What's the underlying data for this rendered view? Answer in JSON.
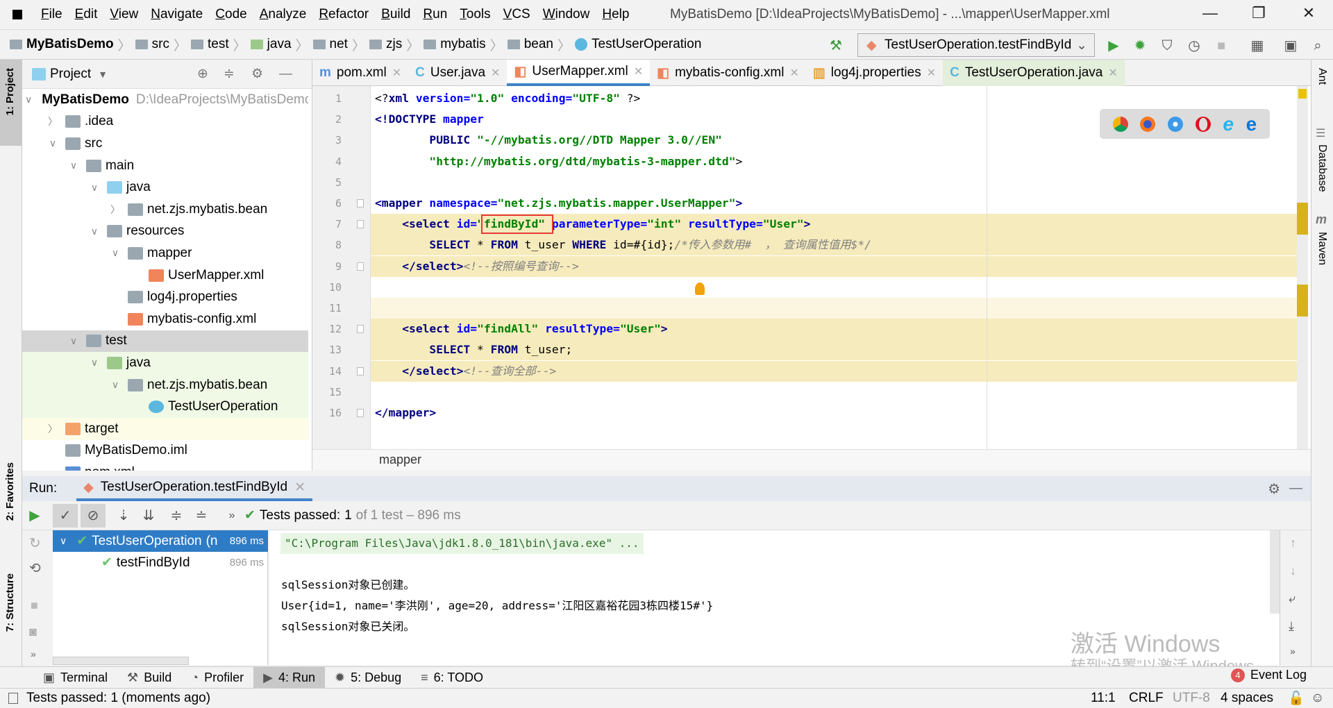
{
  "menu": [
    "File",
    "Edit",
    "View",
    "Navigate",
    "Code",
    "Analyze",
    "Refactor",
    "Build",
    "Run",
    "Tools",
    "VCS",
    "Window",
    "Help"
  ],
  "window_title": "MyBatisDemo [D:\\IdeaProjects\\MyBatisDemo] - ...\\mapper\\UserMapper.xml",
  "breadcrumb": [
    "MyBatisDemo",
    "src",
    "test",
    "java",
    "net",
    "zjs",
    "mybatis",
    "bean",
    "TestUserOperation"
  ],
  "run_config": "TestUserOperation.testFindById",
  "project_panel": {
    "title": "Project",
    "tree": [
      {
        "label": "MyBatisDemo",
        "extra": "D:\\IdeaProjects\\MyBatisDemo",
        "level": 0,
        "state": "open",
        "icon": "module",
        "bold": true
      },
      {
        "label": ".idea",
        "level": 1,
        "state": "closed",
        "icon": "folder"
      },
      {
        "label": "src",
        "level": 1,
        "state": "open",
        "icon": "folder"
      },
      {
        "label": "main",
        "level": 2,
        "state": "open",
        "icon": "folder"
      },
      {
        "label": "java",
        "level": 3,
        "state": "open",
        "icon": "source-folder"
      },
      {
        "label": "net.zjs.mybatis.bean",
        "level": 4,
        "state": "closed",
        "icon": "package"
      },
      {
        "label": "resources",
        "level": 3,
        "state": "open",
        "icon": "resources-folder"
      },
      {
        "label": "mapper",
        "level": 4,
        "state": "open",
        "icon": "package"
      },
      {
        "label": "UserMapper.xml",
        "level": 5,
        "state": "leaf",
        "icon": "xml-file"
      },
      {
        "label": "log4j.properties",
        "level": 4,
        "state": "leaf",
        "icon": "properties-file"
      },
      {
        "label": "mybatis-config.xml",
        "level": 4,
        "state": "leaf",
        "icon": "xml-file"
      },
      {
        "label": "test",
        "level": 2,
        "state": "open",
        "icon": "folder",
        "selected": true
      },
      {
        "label": "java",
        "level": 3,
        "state": "open",
        "icon": "test-folder",
        "bg": "test"
      },
      {
        "label": "net.zjs.mybatis.bean",
        "level": 4,
        "state": "open",
        "icon": "package",
        "bg": "test"
      },
      {
        "label": "TestUserOperation",
        "level": 5,
        "state": "leaf",
        "icon": "class-file",
        "bg": "test"
      },
      {
        "label": "target",
        "level": 1,
        "state": "closed",
        "icon": "excluded-folder",
        "bg": "excluded"
      },
      {
        "label": "MyBatisDemo.iml",
        "level": 1,
        "state": "leaf",
        "icon": "iml-file"
      },
      {
        "label": "pom.xml",
        "level": 1,
        "state": "leaf",
        "icon": "maven-file"
      }
    ]
  },
  "tabs": [
    {
      "label": "pom.xml",
      "icon": "maven-icon"
    },
    {
      "label": "User.java",
      "icon": "class-icon"
    },
    {
      "label": "UserMapper.xml",
      "icon": "xml-icon",
      "active": true
    },
    {
      "label": "mybatis-config.xml",
      "icon": "xml-icon"
    },
    {
      "label": "log4j.properties",
      "icon": "properties-icon"
    },
    {
      "label": "TestUserOperation.java",
      "icon": "test-class-icon",
      "green": true
    }
  ],
  "editor": {
    "lines": [
      [
        [
          "<?",
          "t-pl"
        ],
        [
          "xml ",
          "t-tag"
        ],
        [
          "version=",
          "t-attr"
        ],
        [
          "\"1.0\" ",
          "t-str"
        ],
        [
          "encoding=",
          "t-attr"
        ],
        [
          "\"UTF-8\" ",
          "t-str"
        ],
        [
          "?>",
          "t-pl"
        ]
      ],
      [
        [
          "<!DOCTYPE ",
          "t-tag"
        ],
        [
          "mapper",
          "t-attr"
        ]
      ],
      [
        [
          "        PUBLIC ",
          "t-kw"
        ],
        [
          "\"-//mybatis.org//DTD Mapper 3.0//EN\"",
          "t-str"
        ]
      ],
      [
        [
          "        ",
          "t-pl"
        ],
        [
          "\"http://mybatis.org/dtd/mybatis-3-mapper.dtd\"",
          "t-str"
        ],
        [
          ">",
          "t-pl"
        ]
      ],
      [],
      [
        [
          "<mapper ",
          "t-tag"
        ],
        [
          "namespace=",
          "t-attr"
        ],
        [
          "\"net.zjs.mybatis.mapper.UserMapper\"",
          "t-str"
        ],
        [
          ">",
          "t-tag"
        ]
      ],
      [
        [
          "    <select ",
          "t-tag"
        ],
        [
          "id=",
          "t-attr"
        ],
        [
          "\"findById\"",
          "t-str"
        ],
        [
          " parameterType=",
          "t-attr"
        ],
        [
          "\"int\"",
          "t-str"
        ],
        [
          " resultType=",
          "t-attr"
        ],
        [
          "\"User\"",
          "t-str"
        ],
        [
          ">",
          "t-tag"
        ]
      ],
      [
        [
          "        SELECT ",
          "t-kw"
        ],
        [
          "* ",
          "t-pl"
        ],
        [
          "FROM ",
          "t-kw"
        ],
        [
          "t_user ",
          "t-pl"
        ],
        [
          "WHERE ",
          "t-kw"
        ],
        [
          "id=#{id};",
          "t-pl"
        ],
        [
          "/*传入参数用#  ， 查询属性值用$*/",
          "t-com"
        ]
      ],
      [
        [
          "    </select>",
          "t-tag"
        ],
        [
          "<!--按照编号查询-->",
          "t-com"
        ]
      ],
      [],
      [],
      [
        [
          "    <select ",
          "t-tag"
        ],
        [
          "id=",
          "t-attr"
        ],
        [
          "\"findAll\"",
          "t-str"
        ],
        [
          " resultType=",
          "t-attr"
        ],
        [
          "\"User\"",
          "t-str"
        ],
        [
          ">",
          "t-tag"
        ]
      ],
      [
        [
          "        SELECT ",
          "t-kw"
        ],
        [
          "* ",
          "t-pl"
        ],
        [
          "FROM ",
          "t-kw"
        ],
        [
          "t_user;",
          "t-pl"
        ]
      ],
      [
        [
          "    </select>",
          "t-tag"
        ],
        [
          "<!--查询全部-->",
          "t-com"
        ]
      ],
      [],
      [
        [
          "</mapper>",
          "t-tag"
        ]
      ]
    ],
    "highlight_lines": [
      7,
      8,
      9,
      12,
      13,
      14
    ],
    "current_line": 11,
    "breadcrumb": "mapper"
  },
  "right_tools": [
    "Ant",
    "Database",
    "Maven"
  ],
  "left_tools": [
    "1: Project",
    "2: Favorites",
    "7: Structure"
  ],
  "run": {
    "label": "Run:",
    "tab": "TestUserOperation.testFindById",
    "status_prefix": "Tests passed:",
    "status_count": "1",
    "status_rest": "of 1 test – 896 ms",
    "tree": [
      {
        "label": "TestUserOperation",
        "extra": "(n",
        "time": "896 ms",
        "selected": true
      },
      {
        "label": "testFindById",
        "time": "896 ms"
      }
    ],
    "console": [
      "\"C:\\Program Files\\Java\\jdk1.8.0_181\\bin\\java.exe\" ...",
      "",
      "sqlSession对象已创建。",
      "User{id=1, name='李洪刚', age=20, address='江阳区嘉裕花园3栋四楼15#'}",
      "sqlSession对象已关闭。"
    ]
  },
  "watermark": {
    "line1": "激活 Windows",
    "line2": "转到“设置”以激活 Windows。"
  },
  "bottom_tabs": [
    {
      "label": "Terminal",
      "icon": "terminal-icon"
    },
    {
      "label": "Build",
      "icon": "hammer-icon"
    },
    {
      "label": "Profiler",
      "icon": "profiler-icon"
    },
    {
      "label": "4: Run",
      "icon": "run-icon",
      "active": true
    },
    {
      "label": "5: Debug",
      "icon": "bug-icon"
    },
    {
      "label": "6: TODO",
      "icon": "list-icon"
    }
  ],
  "event_log": {
    "count": "4",
    "label": "Event Log"
  },
  "status": {
    "message": "Tests passed: 1 (moments ago)",
    "position": "11:1",
    "line_sep": "CRLF",
    "encoding": "UTF-8",
    "indent": "4 spaces"
  },
  "colors": {
    "accent": "#4083c9",
    "highlight": "#f6ebbc",
    "test_bg": "#eff9e6",
    "excluded_bg": "#fdfde7",
    "selected_row": "#2f7cc6",
    "run_green": "#3ea33e"
  }
}
